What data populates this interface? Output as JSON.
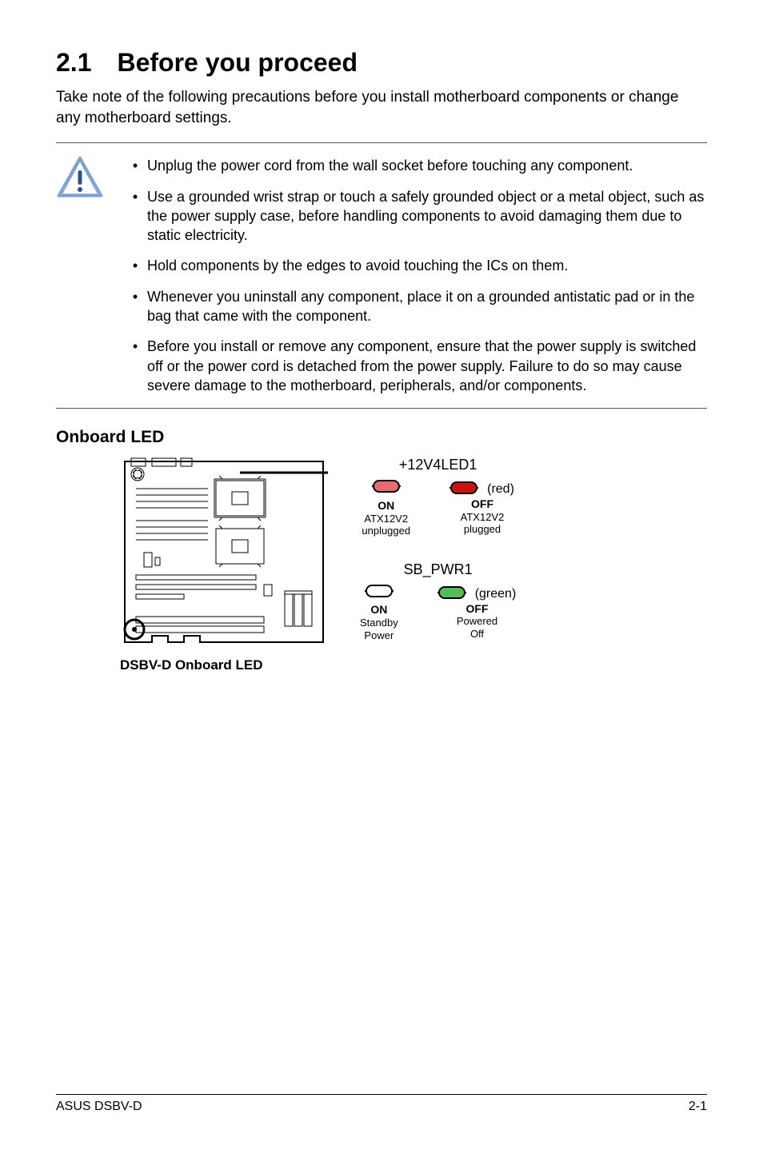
{
  "heading": "2.1 Before you proceed",
  "intro": "Take note of the following precautions before you install motherboard components or change any motherboard settings.",
  "bullets": [
    "Unplug the power cord from the wall socket before touching any component.",
    "Use a grounded wrist strap or touch  a safely grounded object or a metal object, such as the power supply case, before handling components to avoid damaging them due to static electricity.",
    "Hold components by the edges to avoid touching the ICs on them.",
    "Whenever you uninstall any component, place it on a grounded antistatic pad or in the bag that came with the component.",
    "Before you install or remove any component, ensure that the power supply is switched off or the power cord is detached from the power supply. Failure to do so may cause severe damage to the motherboard, peripherals, and/or components."
  ],
  "subhead": "Onboard LED",
  "board_caption": "DSBV-D Onboard LED",
  "led1": {
    "title": "+12V4LED1",
    "color_note": "(red)",
    "on_state": "ON",
    "on_desc1": "ATX12V2",
    "on_desc2": "unplugged",
    "off_state": "OFF",
    "off_desc1": "ATX12V2",
    "off_desc2": "plugged"
  },
  "led2": {
    "title": "SB_PWR1",
    "color_note": "(green)",
    "on_state": "ON",
    "on_desc1": "Standby",
    "on_desc2": "Power",
    "off_state": "OFF",
    "off_desc1": "Powered",
    "off_desc2": "Off"
  },
  "footer_left": "ASUS DSBV-D",
  "footer_right": "2-1"
}
